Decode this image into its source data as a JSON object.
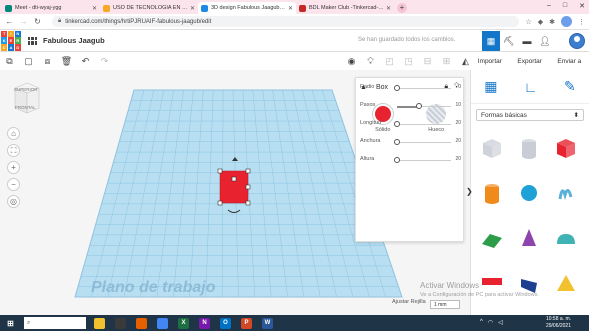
{
  "browser": {
    "tabs": [
      {
        "title": "Meet - dti-wyaj-ygg",
        "color": "#00897b",
        "active": false
      },
      {
        "title": "USO DE TECNOLOGIA EN FAMI…",
        "color": "#f9a825",
        "active": false
      },
      {
        "title": "3D design Fabulous Jaagub | Tin…",
        "color": "#1e88e5",
        "active": true
      },
      {
        "title": "BDL Maker Club -Tinkercad- Hu…",
        "color": "#c62828",
        "active": false
      }
    ],
    "new_tab": "+",
    "url": "tinkercad.com/things/hrtiPJRUAIF-fabulous-jaagub/edit",
    "window_controls": [
      "–",
      "□",
      "✕"
    ]
  },
  "tinkercad": {
    "logo_letters": [
      "TIN",
      "KER",
      "CAD"
    ],
    "logo_colors": [
      "#e8423b",
      "#f5a623",
      "#1477d2",
      "#1e9be9",
      "#e8423b",
      "#4caf50",
      "#f5a623",
      "#1477d2",
      "#e8423b"
    ],
    "design_title": "Fabulous Jaagub",
    "saved_message": "Se han guardado todos los cambios.",
    "right_menu": {
      "import": "Importar",
      "export": "Exportar",
      "send": "Enviar a"
    }
  },
  "viewcube": {
    "top": "SUPERIOR",
    "front": "FRONTAL"
  },
  "inspector": {
    "title": "Box",
    "solid_label": "Sólido",
    "hole_label": "Hueco",
    "solid_color": "#e8232f",
    "props": [
      {
        "label": "Radio",
        "value": "0",
        "fraction": 0.0
      },
      {
        "label": "Pasos",
        "value": "10",
        "fraction": 0.4
      },
      {
        "label": "Longitud",
        "value": "20",
        "fraction": 0.0
      },
      {
        "label": "Anchura",
        "value": "20",
        "fraction": 0.0
      },
      {
        "label": "Altura",
        "value": "20",
        "fraction": 0.0
      }
    ]
  },
  "shapes_panel": {
    "category": "Formas básicas",
    "shapes": [
      {
        "name": "box-hole",
        "color": "#c9ced6"
      },
      {
        "name": "cylinder-hole",
        "color": "#c9ced6"
      },
      {
        "name": "box",
        "color": "#e8232f"
      },
      {
        "name": "cylinder",
        "color": "#f08a1b"
      },
      {
        "name": "sphere",
        "color": "#1da1d6"
      },
      {
        "name": "scribble",
        "color": "#5ab0d8"
      },
      {
        "name": "roof",
        "color": "#2e9d4a"
      },
      {
        "name": "cone",
        "color": "#8e44ad"
      },
      {
        "name": "round-roof",
        "color": "#3fb3b3"
      },
      {
        "name": "text",
        "color": "#e8232f"
      },
      {
        "name": "wedge",
        "color": "#1d3f8f"
      },
      {
        "name": "pyramid",
        "color": "#f2c12e"
      }
    ]
  },
  "workplane": {
    "label": "Plano de trabajo",
    "snap_label": "Ajustar Rejilla",
    "snap_value": "1 mm",
    "box_color": "#e8232f"
  },
  "windows_watermark": {
    "line1": "Activar Windows",
    "line2": "Ve a Configuración de PC para activar Windows."
  },
  "taskbar": {
    "search_placeholder": "",
    "time": "10:58 a. m.",
    "date": "29/06/2021",
    "apps": [
      {
        "name": "file-explorer",
        "color": "#f2c12e",
        "glyph": ""
      },
      {
        "name": "calculator",
        "color": "#3a3a3a",
        "glyph": ""
      },
      {
        "name": "firefox",
        "color": "#e66000",
        "glyph": ""
      },
      {
        "name": "chrome",
        "color": "#4285f4",
        "glyph": ""
      },
      {
        "name": "excel",
        "color": "#1d6f42",
        "glyph": "X"
      },
      {
        "name": "onenote",
        "color": "#7719aa",
        "glyph": "N"
      },
      {
        "name": "outlook",
        "color": "#0072c6",
        "glyph": "O"
      },
      {
        "name": "powerpoint",
        "color": "#d24726",
        "glyph": "P"
      },
      {
        "name": "word",
        "color": "#2b579a",
        "glyph": "W"
      }
    ]
  }
}
